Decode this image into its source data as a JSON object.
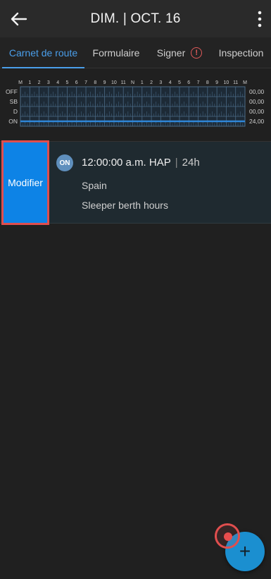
{
  "header": {
    "title": "DIM. | OCT. 16",
    "back_icon": "arrow-left-icon",
    "menu_icon": "more-vertical-icon"
  },
  "tabs": [
    {
      "label": "Carnet de route",
      "active": true
    },
    {
      "label": "Formulaire",
      "active": false
    },
    {
      "label": "Signer",
      "active": false,
      "alert_icon": "alert-circle-icon",
      "alert_symbol": "!"
    },
    {
      "label": "Inspection",
      "active": false
    }
  ],
  "log_graph": {
    "hour_labels": [
      "M",
      "1",
      "2",
      "3",
      "4",
      "5",
      "6",
      "7",
      "8",
      "9",
      "10",
      "11",
      "N",
      "1",
      "2",
      "3",
      "4",
      "5",
      "6",
      "7",
      "8",
      "9",
      "10",
      "11",
      "M"
    ],
    "rows": [
      {
        "label": "OFF",
        "total": "00,00"
      },
      {
        "label": "SB",
        "total": "00,00"
      },
      {
        "label": "D",
        "total": "00,00"
      },
      {
        "label": "ON",
        "total": "24,00"
      }
    ],
    "active_row": "ON",
    "line_color": "#2f86d8"
  },
  "entry": {
    "edit_label": "Modifier",
    "status_badge": "ON",
    "time": "12:00:00 a.m. HAP",
    "duration": "24h",
    "location": "Spain",
    "note": "Sleeper berth hours"
  },
  "fab": {
    "icon": "plus-icon",
    "symbol": "+"
  },
  "colors": {
    "accent": "#4a9eea",
    "edit_button": "#0d83e6",
    "highlight": "#e04e4e",
    "fab": "#1b8fd0"
  }
}
